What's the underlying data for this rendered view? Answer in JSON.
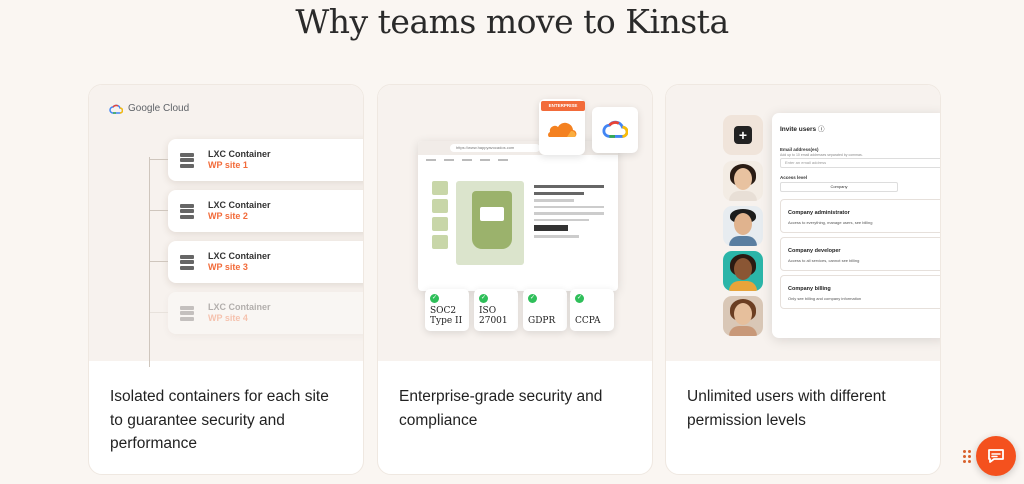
{
  "heading": "Why teams move to Kinsta",
  "cards": [
    {
      "caption": "Isolated containers for each site to guarantee security and performance",
      "logo_text": "Google Cloud",
      "containers": [
        {
          "title": "LXC Container",
          "site": "WP site 1"
        },
        {
          "title": "LXC Container",
          "site": "WP site 2"
        },
        {
          "title": "LXC Container",
          "site": "WP site 3"
        },
        {
          "title": "LXC Container",
          "site": "WP site 4"
        }
      ]
    },
    {
      "caption": "Enterprise-grade security and compliance",
      "badge": "ENTERPRISE",
      "url": "https://www.happyavocados.com",
      "certs": [
        "SOC2 Type II",
        "ISO 27001",
        "GDPR",
        "CCPA"
      ]
    },
    {
      "caption": "Unlimited users with different permission levels",
      "panel": {
        "title": "Invite users",
        "email_label": "Email address(es)",
        "email_sub": "Add up to 10 email addresses separated by commas.",
        "email_placeholder": "Enter an email address",
        "access_label": "Access level",
        "access_value": "Company",
        "roles": [
          {
            "title": "Company administrator",
            "desc": "Access to everything, manage users, see billing"
          },
          {
            "title": "Company developer",
            "desc": "Access to all services, cannot see billing"
          },
          {
            "title": "Company billing",
            "desc": "Only see billing and company information"
          }
        ]
      }
    }
  ],
  "colors": {
    "accent": "#f26b3a",
    "chat": "#f4511e"
  },
  "icons": {
    "chat": "chat-bubble-icon",
    "grip": "drag-grip-icon"
  }
}
